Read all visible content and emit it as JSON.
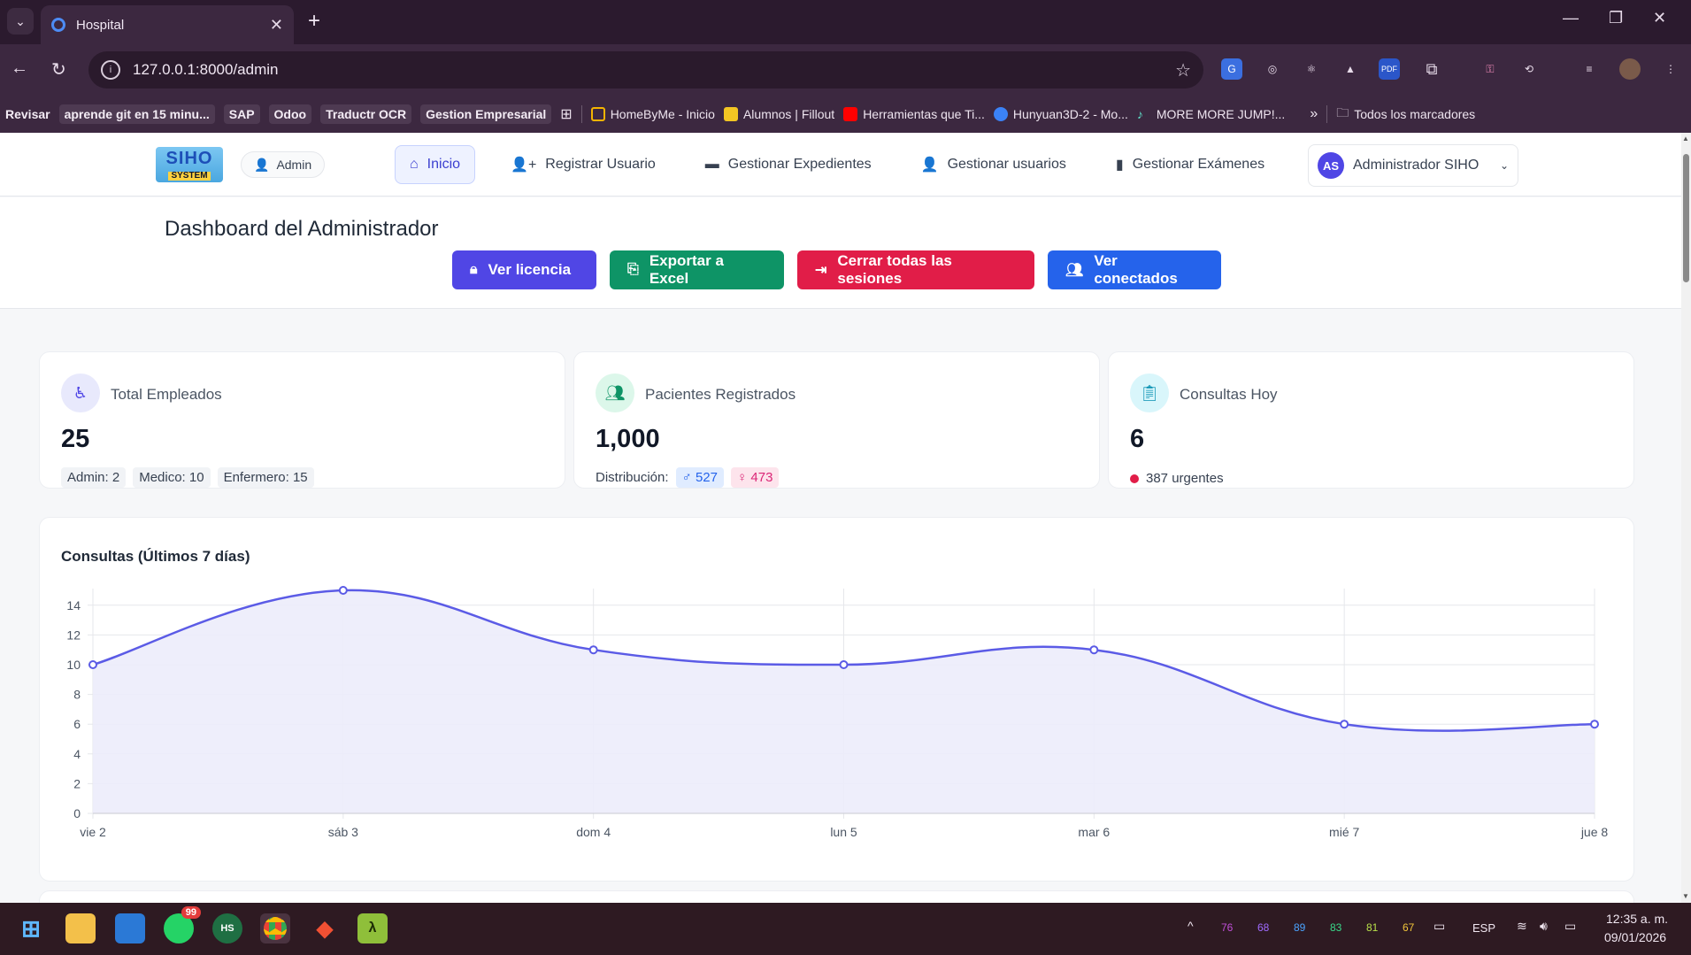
{
  "browser": {
    "tab_title": "Hospital",
    "url": "127.0.0.1:8000/admin",
    "bookmarks": [
      {
        "label": "Revisar",
        "style": "plain"
      },
      {
        "label": "aprende git en 15 minu...",
        "style": "chip"
      },
      {
        "label": "SAP",
        "style": "chip"
      },
      {
        "label": "Odoo",
        "style": "chip"
      },
      {
        "label": "Traductr OCR",
        "style": "chip"
      },
      {
        "label": "Gestion Empresarial",
        "style": "chip"
      },
      {
        "label": "HomeByMe - Inicio",
        "style": "icon",
        "color": "#f5b400"
      },
      {
        "label": "Alumnos | Fillout",
        "style": "icon",
        "color": "#f3c623"
      },
      {
        "label": "Herramientas que Ti...",
        "style": "icon",
        "color": "#ff0000"
      },
      {
        "label": "Hunyuan3D-2 - Mo...",
        "style": "icon",
        "color": "#3b82f6"
      },
      {
        "label": "MORE MORE JUMP!...",
        "style": "icon",
        "color": "#5ee0c8"
      }
    ],
    "all_bookmarks_label": "Todos los marcadores"
  },
  "app": {
    "logo_line1": "SIHO",
    "logo_line2": "SYSTEM",
    "role": "Admin",
    "nav": [
      {
        "label": "Inicio",
        "icon": "home-icon",
        "active": true
      },
      {
        "label": "Registrar Usuario",
        "icon": "user-plus-icon",
        "active": false
      },
      {
        "label": "Gestionar Expedientes",
        "icon": "folder-icon",
        "active": false
      },
      {
        "label": "Gestionar usuarios",
        "icon": "user-icon",
        "active": false
      },
      {
        "label": "Gestionar Exámenes",
        "icon": "file-icon",
        "active": false
      }
    ],
    "user": {
      "initials": "AS",
      "name": "Administrador SIHO"
    }
  },
  "dashboard": {
    "title": "Dashboard del Administrador",
    "actions": {
      "license": "Ver licencia",
      "export": "Exportar a Excel",
      "logout_all": "Cerrar todas las sesiones",
      "connected": "Ver conectados"
    },
    "employees": {
      "label": "Total Empleados",
      "value": "25",
      "breakdown": [
        "Admin: 2",
        "Medico: 10",
        "Enfermero: 15"
      ]
    },
    "patients": {
      "label": "Pacientes Registrados",
      "value": "1,000",
      "distribution_label": "Distribución:",
      "male": "527",
      "female": "473"
    },
    "consults": {
      "label": "Consultas Hoy",
      "value": "6",
      "urgent": "387 urgentes"
    },
    "chart_title": "Consultas (Últimos 7 días)"
  },
  "chart_data": {
    "type": "area",
    "categories": [
      "vie 2",
      "sáb 3",
      "dom 4",
      "lun 5",
      "mar 6",
      "mié 7",
      "jue 8"
    ],
    "values": [
      10,
      15,
      11,
      10,
      11,
      6,
      6
    ],
    "ylim": [
      0,
      15
    ],
    "yticks": [
      0,
      2,
      4,
      6,
      8,
      10,
      12,
      14
    ],
    "grid": true,
    "color": "#5b5be6",
    "fill": "#ececfb"
  },
  "taskbar": {
    "whatsapp_badge": "99",
    "tray_numbers": [
      {
        "value": "76",
        "color": "#c04fd8"
      },
      {
        "value": "68",
        "color": "#a06bff"
      },
      {
        "value": "89",
        "color": "#4aa3ff"
      },
      {
        "value": "83",
        "color": "#39d98a"
      },
      {
        "value": "81",
        "color": "#b8e04a"
      },
      {
        "value": "67",
        "color": "#f0c43a"
      }
    ],
    "language": "ESP",
    "time": "12:35 a. m.",
    "date": "09/01/2026"
  }
}
